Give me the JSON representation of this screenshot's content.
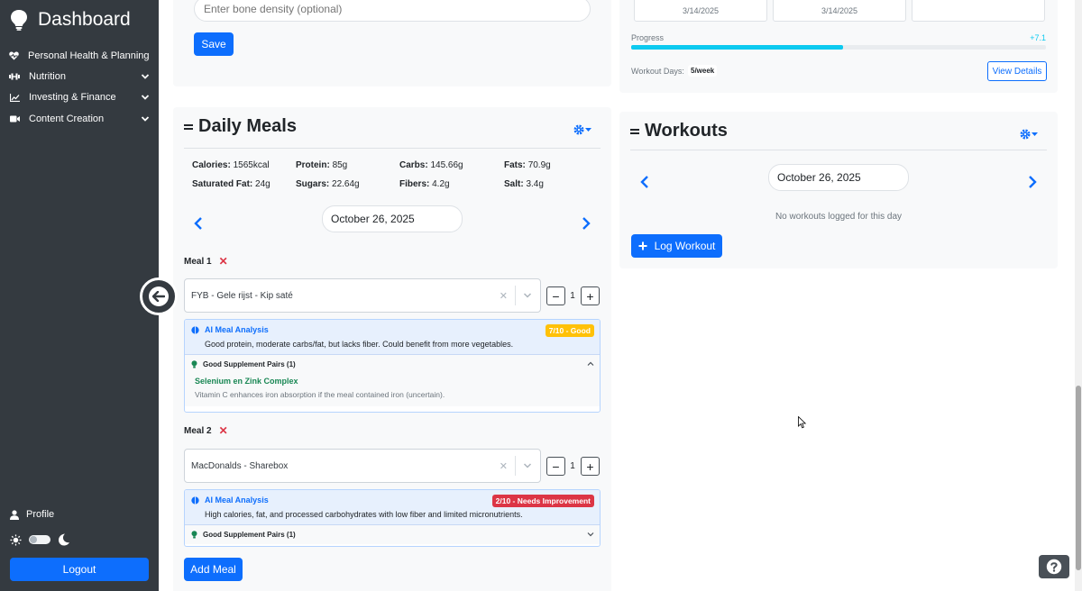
{
  "sidebar": {
    "brand": "Dashboard",
    "items": [
      {
        "label": "Personal Health & Planning",
        "icon": "heart-pulse-icon"
      },
      {
        "label": "Nutrition",
        "icon": "dumbbell-icon"
      },
      {
        "label": "Investing & Finance",
        "icon": "chart-line-icon"
      },
      {
        "label": "Content Creation",
        "icon": "video-icon"
      }
    ],
    "profile": "Profile",
    "logout": "Logout"
  },
  "bone_form": {
    "placeholder": "Enter bone density (optional)",
    "save": "Save"
  },
  "top_right": {
    "tile_dates": [
      "3/14/2025",
      "3/14/2025"
    ],
    "progress_label": "Progress",
    "progress_value": "+7.1",
    "progress_fraction": 0.51,
    "workout_days_label": "Workout Days:",
    "workout_days_value": "5/week",
    "view_details": "View Details"
  },
  "meals": {
    "title": "Daily Meals",
    "nutrients": [
      {
        "label": "Calories:",
        "value": "1565kcal"
      },
      {
        "label": "Protein:",
        "value": "85g"
      },
      {
        "label": "Carbs:",
        "value": "145.66g"
      },
      {
        "label": "Fats:",
        "value": "70.9g"
      },
      {
        "label": "Saturated Fat:",
        "value": "24g"
      },
      {
        "label": "Sugars:",
        "value": "22.64g"
      },
      {
        "label": "Fibers:",
        "value": "4.2g"
      },
      {
        "label": "Salt:",
        "value": "3.4g"
      }
    ],
    "date": "October 26, 2025",
    "items": [
      {
        "label": "Meal 1",
        "food": "FYB - Gele rijst - Kip saté",
        "quantity": "1",
        "ai_title": "AI Meal Analysis",
        "ai_text": "Good protein, moderate carbs/fat, but lacks fiber. Could benefit from more vegetables.",
        "score": "7/10 - Good",
        "supp_title": "Good Supplement Pairs (1)",
        "supp_name": "Selenium en Zink Complex",
        "supp_note": "Vitamin C enhances iron absorption if the meal contained iron (uncertain)."
      },
      {
        "label": "Meal 2",
        "food": "MacDonalds - Sharebox",
        "quantity": "1",
        "ai_title": "AI Meal Analysis",
        "ai_text": "High calories, fat, and processed carbohydrates with low fiber and limited micronutrients.",
        "score": "2/10 - Needs Improvement",
        "supp_title": "Good Supplement Pairs (1)"
      }
    ],
    "add_meal": "Add Meal"
  },
  "workouts": {
    "title": "Workouts",
    "date": "October 26, 2025",
    "empty": "No workouts logged for this day",
    "log": "Log Workout"
  },
  "colors": {
    "sidebar": "#343a40",
    "primary": "#0d6efd",
    "good": "#ffc107",
    "bad": "#dc3545",
    "supplement": "#198754",
    "progress": "#0dcaf0"
  }
}
